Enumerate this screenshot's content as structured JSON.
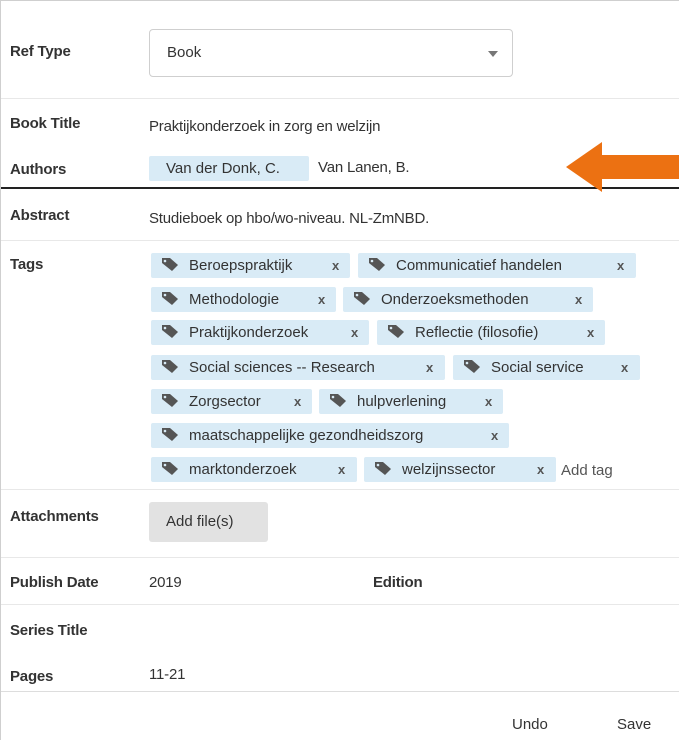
{
  "fields": {
    "ref_type": {
      "label": "Ref Type",
      "value": "Book"
    },
    "book_title": {
      "label": "Book Title",
      "value": "Praktijkonderzoek in zorg en welzijn"
    },
    "authors": {
      "label": "Authors",
      "items": [
        "Van der Donk, C.",
        "Van Lanen, B."
      ]
    },
    "abstract": {
      "label": "Abstract",
      "value": "Studieboek op hbo/wo-niveau. NL-ZmNBD."
    },
    "tags": {
      "label": "Tags",
      "items": [
        "Beroepspraktijk",
        "Communicatief handelen",
        "Methodologie",
        "Onderzoeksmethoden",
        "Praktijkonderzoek",
        "Reflectie (filosofie)",
        "Social sciences -- Research",
        "Social service",
        "Zorgsector",
        "hulpverlening",
        "maatschappelijke gezondheidszorg",
        "marktonderzoek",
        "welzijnssector"
      ],
      "remove_glyph": "x",
      "add_placeholder": "Add tag",
      "icon": "tag-icon"
    },
    "attachments": {
      "label": "Attachments",
      "button": "Add file(s)"
    },
    "publish_date": {
      "label": "Publish Date",
      "value": "2019"
    },
    "edition": {
      "label": "Edition",
      "value": ""
    },
    "series_title": {
      "label": "Series Title",
      "value": ""
    },
    "pages": {
      "label": "Pages",
      "value": "11-21"
    }
  },
  "footer": {
    "undo": "Undo",
    "save": "Save"
  },
  "colors": {
    "chip_bg": "#d9ebf6",
    "arrow": "#ec7112",
    "button_bg": "#e2e2e2"
  }
}
